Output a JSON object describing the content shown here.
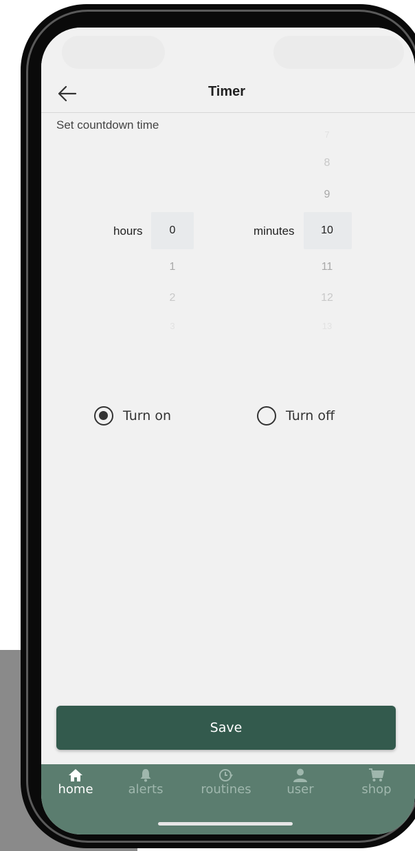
{
  "header": {
    "title": "Timer"
  },
  "subtitle": "Set countdown time",
  "picker": {
    "hours_label": "hours",
    "hours_visible": [
      "0",
      "1",
      "2",
      "3"
    ],
    "minutes_label": "minutes",
    "minutes_above": [
      "7",
      "8",
      "9"
    ],
    "minutes_selected": "10",
    "minutes_below": [
      "11",
      "12",
      "13"
    ]
  },
  "options": [
    {
      "label": "Turn on",
      "checked": true
    },
    {
      "label": "Turn off",
      "checked": false
    }
  ],
  "save_label": "Save",
  "tabs": [
    {
      "label": "home",
      "icon": "home-icon",
      "active": true
    },
    {
      "label": "alerts",
      "icon": "bell-icon",
      "active": false
    },
    {
      "label": "routines",
      "icon": "clock-icon",
      "active": false
    },
    {
      "label": "user",
      "icon": "user-icon",
      "active": false
    },
    {
      "label": "shop",
      "icon": "cart-icon",
      "active": false
    }
  ],
  "colors": {
    "accent": "#335a4d",
    "tabbar": "#5b7d6f",
    "tab_inactive": "#9fb7ad"
  }
}
